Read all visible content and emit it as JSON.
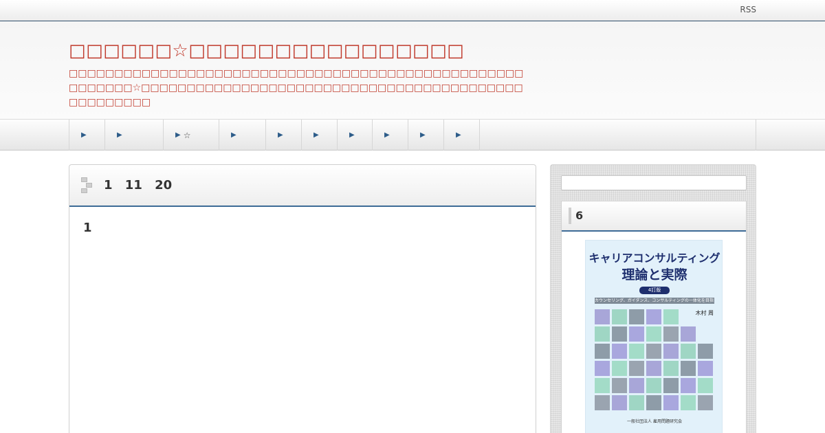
{
  "topbar": {
    "rss_label": "RSS"
  },
  "header": {
    "title": "□□□□□□☆□□□□□□□□□□□□□□□□",
    "description": "□□□□□□□□□□□□□□□□□□□□□□□□□□□□□□□□□□□□□□□□□□□□□□□□□□□□□□□□□☆□□□□□□□□□□□□□□□□□□□□□□□□□□□□□□□□□□□□□□□□□□□□□□□□□□□"
  },
  "nav": {
    "items": [
      {
        "label": ""
      },
      {
        "label": ""
      },
      {
        "label": "☆"
      },
      {
        "label": ""
      },
      {
        "label": ""
      },
      {
        "label": ""
      },
      {
        "label": ""
      },
      {
        "label": ""
      },
      {
        "label": ""
      },
      {
        "label": ""
      }
    ]
  },
  "post": {
    "title": "1 11 20",
    "heading": "1"
  },
  "sidebar": {
    "search": {
      "placeholder": ""
    },
    "widget": {
      "title": "6",
      "book": {
        "title_line1": "キャリアコンサルティング",
        "title_line2": "理論と実際",
        "edition": "4訂版",
        "subtitle": "カウンセリング、ガイダンス、コンサルティングの一体化を目指して",
        "author": "木村 周",
        "publisher": "一般社団法人 雇用問題研究会",
        "tile_colors": [
          "#a8a6d8",
          "#9fd6c4",
          "#8e9ca8",
          "#a9a7de",
          "#a3dcc8",
          "#9aa4b0"
        ]
      }
    }
  },
  "colors": {
    "accent": "#3c6a96",
    "title": "#c0392b",
    "book_title": "#1e2f6e"
  }
}
